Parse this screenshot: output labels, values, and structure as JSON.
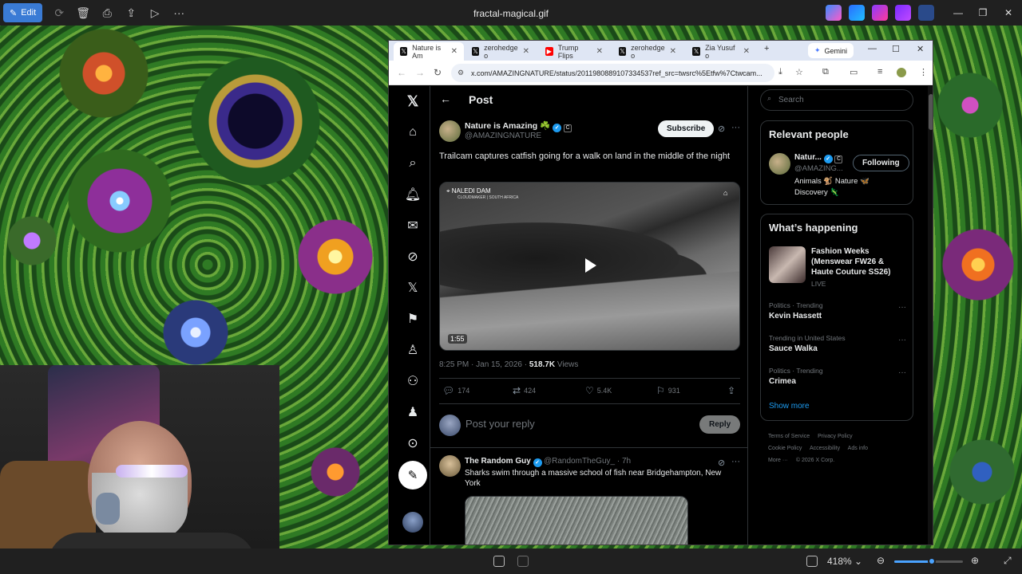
{
  "viewer": {
    "title": "fractal-magical.gif",
    "edit_label": "Edit",
    "zoom": "418%",
    "zoom_level": 0.55
  },
  "browser": {
    "tabs": [
      {
        "label": "Nature is Am",
        "icon": "x-logo-icon",
        "active": true
      },
      {
        "label": "zerohedge o",
        "icon": "x-logo-icon",
        "active": false
      },
      {
        "label": "Trump Flips",
        "icon": "youtube-icon",
        "active": false
      },
      {
        "label": "zerohedge o",
        "icon": "x-logo-icon",
        "active": false
      },
      {
        "label": "Zia Yusuf o",
        "icon": "x-logo-icon",
        "active": false
      }
    ],
    "gemini_label": "Gemini",
    "url": "x.com/AMAZINGNATURE/status/2011980889107334537ref_src=twsrc%5Etfw%7Ctwcam..."
  },
  "post": {
    "heading": "Post",
    "author_name": "Nature is Amazing ☘️",
    "author_handle": "@AMAZINGNATURE",
    "subscribe_label": "Subscribe",
    "text": "Trailcam captures catfish going for a walk on land in the middle of the night",
    "video_location": "NALEDI DAM",
    "video_sublocation": "CLOUDMAKER | SOUTH AFRICA",
    "video_time": "1:55",
    "time": "8:25 PM · Jan 15, 2026 · ",
    "views_count": "518.7K",
    "views_label": " Views",
    "stats": {
      "replies": "174",
      "reposts": "424",
      "likes": "5.4K",
      "bookmarks": "931"
    },
    "reply_placeholder": "Post your reply",
    "reply_button": "Reply"
  },
  "second_tweet": {
    "name": "The Random Guy",
    "handle": "@RandomTheGuy_ · 7h",
    "text": "Sharks swim through a massive school of fish near Bridgehampton, New York"
  },
  "sidebar": {
    "search_placeholder": "Search",
    "relevant_title": "Relevant people",
    "person_name": "Natur...",
    "person_handle": "@AMAZING...",
    "person_bio_1": "Animals 🐒 Nature 🦋",
    "person_bio_2": "Discovery 🦎",
    "following_label": "Following",
    "happening_title": "What’s happening",
    "event_title": "Fashion Weeks (Menswear FW26 & Haute Couture SS26)",
    "event_status": "LIVE",
    "trends": [
      {
        "label": "Politics · Trending",
        "name": "Kevin Hassett"
      },
      {
        "label": "Trending in United States",
        "name": "Sauce Walka"
      },
      {
        "label": "Politics · Trending",
        "name": "Crimea"
      }
    ],
    "show_more": "Show more",
    "footer": [
      "Terms of Service",
      "Privacy Policy",
      "Cookie Policy",
      "Accessibility",
      "Ads info",
      "More ···",
      "© 2026 X Corp."
    ]
  }
}
